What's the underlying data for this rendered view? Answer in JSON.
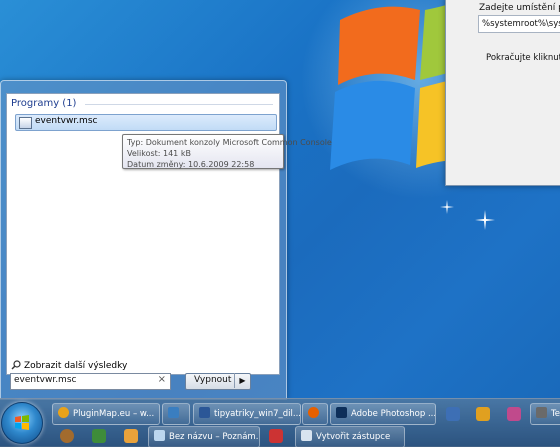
{
  "dialog": {
    "location_label": "Zadejte umístění polož",
    "location_value": "%systemroot%\\syste",
    "hint": "Pokračujte kliknutím n"
  },
  "start_menu": {
    "programs_header": "Programy (1)",
    "result_label": "eventvwr.msc",
    "more_results": "Zobrazit další výsledky",
    "search_value": "eventvwr.msc",
    "search_clear": "×",
    "shutdown_label": "Vypnout",
    "shutdown_arrow": "▶"
  },
  "tooltip": {
    "type": "Typ: Dokument konzoly Microsoft Common Console",
    "size": "Velikost: 141 kB",
    "modified": "Datum změny: 10.6.2009 22:58"
  },
  "taskbar": {
    "tasks_row1": [
      {
        "label": "PluginMap.eu – w...",
        "color": "#e8a21a"
      },
      {
        "label": "",
        "color": "#3a7ec0"
      },
      {
        "label": "tipyatriky_win7_dil...",
        "color": "#2b5797"
      },
      {
        "label": "",
        "color": "#e66000"
      },
      {
        "label": "Adobe Photoshop ...",
        "color": "#0d2f5a"
      },
      {
        "label": "Te",
        "color": "#6a6a6a"
      }
    ],
    "tasks_row2": [
      {
        "label": "Bez názvu – Poznám...",
        "color": "#bcd6ee"
      },
      {
        "label": "Vytvořit zástupce",
        "color": "#d8e4f0"
      }
    ]
  }
}
